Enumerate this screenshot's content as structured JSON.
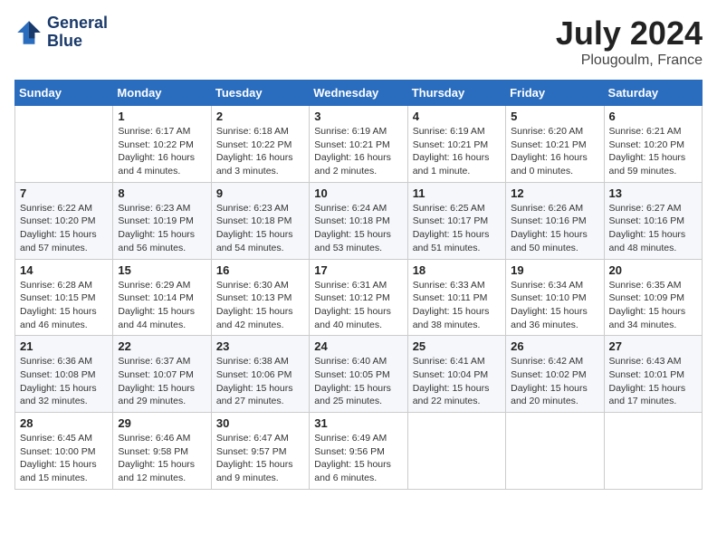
{
  "header": {
    "logo_line1": "General",
    "logo_line2": "Blue",
    "month_year": "July 2024",
    "location": "Plougoulm, France"
  },
  "weekdays": [
    "Sunday",
    "Monday",
    "Tuesday",
    "Wednesday",
    "Thursday",
    "Friday",
    "Saturday"
  ],
  "weeks": [
    [
      {
        "day": "",
        "info": ""
      },
      {
        "day": "1",
        "info": "Sunrise: 6:17 AM\nSunset: 10:22 PM\nDaylight: 16 hours\nand 4 minutes."
      },
      {
        "day": "2",
        "info": "Sunrise: 6:18 AM\nSunset: 10:22 PM\nDaylight: 16 hours\nand 3 minutes."
      },
      {
        "day": "3",
        "info": "Sunrise: 6:19 AM\nSunset: 10:21 PM\nDaylight: 16 hours\nand 2 minutes."
      },
      {
        "day": "4",
        "info": "Sunrise: 6:19 AM\nSunset: 10:21 PM\nDaylight: 16 hours\nand 1 minute."
      },
      {
        "day": "5",
        "info": "Sunrise: 6:20 AM\nSunset: 10:21 PM\nDaylight: 16 hours\nand 0 minutes."
      },
      {
        "day": "6",
        "info": "Sunrise: 6:21 AM\nSunset: 10:20 PM\nDaylight: 15 hours\nand 59 minutes."
      }
    ],
    [
      {
        "day": "7",
        "info": "Sunrise: 6:22 AM\nSunset: 10:20 PM\nDaylight: 15 hours\nand 57 minutes."
      },
      {
        "day": "8",
        "info": "Sunrise: 6:23 AM\nSunset: 10:19 PM\nDaylight: 15 hours\nand 56 minutes."
      },
      {
        "day": "9",
        "info": "Sunrise: 6:23 AM\nSunset: 10:18 PM\nDaylight: 15 hours\nand 54 minutes."
      },
      {
        "day": "10",
        "info": "Sunrise: 6:24 AM\nSunset: 10:18 PM\nDaylight: 15 hours\nand 53 minutes."
      },
      {
        "day": "11",
        "info": "Sunrise: 6:25 AM\nSunset: 10:17 PM\nDaylight: 15 hours\nand 51 minutes."
      },
      {
        "day": "12",
        "info": "Sunrise: 6:26 AM\nSunset: 10:16 PM\nDaylight: 15 hours\nand 50 minutes."
      },
      {
        "day": "13",
        "info": "Sunrise: 6:27 AM\nSunset: 10:16 PM\nDaylight: 15 hours\nand 48 minutes."
      }
    ],
    [
      {
        "day": "14",
        "info": "Sunrise: 6:28 AM\nSunset: 10:15 PM\nDaylight: 15 hours\nand 46 minutes."
      },
      {
        "day": "15",
        "info": "Sunrise: 6:29 AM\nSunset: 10:14 PM\nDaylight: 15 hours\nand 44 minutes."
      },
      {
        "day": "16",
        "info": "Sunrise: 6:30 AM\nSunset: 10:13 PM\nDaylight: 15 hours\nand 42 minutes."
      },
      {
        "day": "17",
        "info": "Sunrise: 6:31 AM\nSunset: 10:12 PM\nDaylight: 15 hours\nand 40 minutes."
      },
      {
        "day": "18",
        "info": "Sunrise: 6:33 AM\nSunset: 10:11 PM\nDaylight: 15 hours\nand 38 minutes."
      },
      {
        "day": "19",
        "info": "Sunrise: 6:34 AM\nSunset: 10:10 PM\nDaylight: 15 hours\nand 36 minutes."
      },
      {
        "day": "20",
        "info": "Sunrise: 6:35 AM\nSunset: 10:09 PM\nDaylight: 15 hours\nand 34 minutes."
      }
    ],
    [
      {
        "day": "21",
        "info": "Sunrise: 6:36 AM\nSunset: 10:08 PM\nDaylight: 15 hours\nand 32 minutes."
      },
      {
        "day": "22",
        "info": "Sunrise: 6:37 AM\nSunset: 10:07 PM\nDaylight: 15 hours\nand 29 minutes."
      },
      {
        "day": "23",
        "info": "Sunrise: 6:38 AM\nSunset: 10:06 PM\nDaylight: 15 hours\nand 27 minutes."
      },
      {
        "day": "24",
        "info": "Sunrise: 6:40 AM\nSunset: 10:05 PM\nDaylight: 15 hours\nand 25 minutes."
      },
      {
        "day": "25",
        "info": "Sunrise: 6:41 AM\nSunset: 10:04 PM\nDaylight: 15 hours\nand 22 minutes."
      },
      {
        "day": "26",
        "info": "Sunrise: 6:42 AM\nSunset: 10:02 PM\nDaylight: 15 hours\nand 20 minutes."
      },
      {
        "day": "27",
        "info": "Sunrise: 6:43 AM\nSunset: 10:01 PM\nDaylight: 15 hours\nand 17 minutes."
      }
    ],
    [
      {
        "day": "28",
        "info": "Sunrise: 6:45 AM\nSunset: 10:00 PM\nDaylight: 15 hours\nand 15 minutes."
      },
      {
        "day": "29",
        "info": "Sunrise: 6:46 AM\nSunset: 9:58 PM\nDaylight: 15 hours\nand 12 minutes."
      },
      {
        "day": "30",
        "info": "Sunrise: 6:47 AM\nSunset: 9:57 PM\nDaylight: 15 hours\nand 9 minutes."
      },
      {
        "day": "31",
        "info": "Sunrise: 6:49 AM\nSunset: 9:56 PM\nDaylight: 15 hours\nand 6 minutes."
      },
      {
        "day": "",
        "info": ""
      },
      {
        "day": "",
        "info": ""
      },
      {
        "day": "",
        "info": ""
      }
    ]
  ]
}
